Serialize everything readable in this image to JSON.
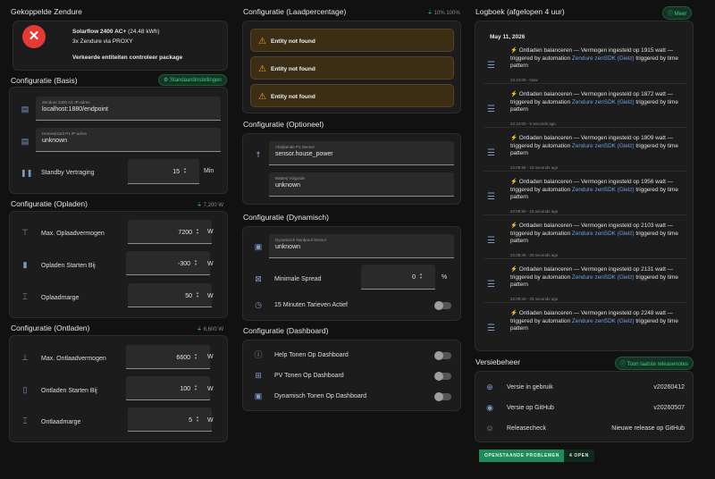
{
  "left": {
    "linked": {
      "title": "Gekoppelde Zendure",
      "device_name": "Solarflow 2400 AC+",
      "device_capacity": "(24.48 kWh)",
      "via": "3x Zendure via PROXY",
      "warning": "Verkeerde entiteiten controleer package"
    },
    "basis": {
      "title": "Configuratie (Basis)",
      "badge": "Standaardinstellingen",
      "ip_label": "Zendure 2400 AC IP-adres",
      "ip_value": "localhost:1880/endpoint",
      "p1_label": "Homewizard P1 IP-adres",
      "p1_value": "unknown",
      "standby_label": "Standby Vertraging",
      "standby_value": "15",
      "standby_unit": "Min"
    },
    "opladen": {
      "title": "Configuratie (Opladen)",
      "badge": "7,200 W",
      "rows": [
        {
          "label": "Max. Oplaadvermogen",
          "value": "7200",
          "unit": "W"
        },
        {
          "label": "Opladen Starten Bij",
          "value": "-300",
          "unit": "W"
        },
        {
          "label": "Oplaadmarge",
          "value": "50",
          "unit": "W"
        }
      ]
    },
    "ontladen": {
      "title": "Configuratie (Ontladen)",
      "badge": "6,600 W",
      "rows": [
        {
          "label": "Max. Ontlaadvermogen",
          "value": "6600",
          "unit": "W"
        },
        {
          "label": "Ontladen Starten Bij",
          "value": "100",
          "unit": "W"
        },
        {
          "label": "Ontlaadmarge",
          "value": "5",
          "unit": "W"
        }
      ]
    }
  },
  "middle": {
    "laad": {
      "title": "Configuratie (Laadpercentage)",
      "badge": "10%  100%",
      "warnings": [
        "Entity not found",
        "Entity not found",
        "Entity not found"
      ]
    },
    "optioneel": {
      "title": "Configuratie (Optioneel)",
      "p1_label": "Afwijkende P1 Sensor",
      "p1_value": "sensor.house_power",
      "bat_label": "Batterij Volgorde",
      "bat_value": "unknown"
    },
    "dynamisch": {
      "title": "Configuratie (Dynamisch)",
      "sensor_label": "Dynamisch Nordpool Sensor",
      "sensor_value": "unknown",
      "spread_label": "Minimale Spread",
      "spread_value": "0",
      "spread_unit": "%",
      "tarieven_label": "15 Minuten Tarieven Actief"
    },
    "dashboard": {
      "title": "Configuratie (Dashboard)",
      "rows": [
        "Help Tonen Op Dashboard",
        "PV Tonen Op Dashboard",
        "Dynamisch Tonen Op Dashboard"
      ]
    }
  },
  "right": {
    "log": {
      "title": "Logboek (afgelopen 4 uur)",
      "badge": "Meer",
      "date": "May 11, 2026",
      "entries": [
        {
          "pre": "Ontladen balanceren — Vermogen ingesteld op 1915 watt — triggered by automation ",
          "auto": "Zendure zenSDK (Gielz)",
          "post": " triggered by time pattern",
          "time": "22:10:05 - Now"
        },
        {
          "pre": "Ontladen balanceren — Vermogen ingesteld op 1872 watt — triggered by automation ",
          "auto": "Zendure zenSDK (Gielz)",
          "post": " triggered by time pattern",
          "time": "22:10:00 - 5 seconds ago"
        },
        {
          "pre": "Ontladen balanceren — Vermogen ingesteld op 1809 watt — triggered by automation ",
          "auto": "Zendure zenSDK (Gielz)",
          "post": " triggered by time pattern",
          "time": "22:09:55 - 10 seconds ago"
        },
        {
          "pre": "Ontladen balanceren — Vermogen ingesteld op 1956 watt — triggered by automation ",
          "auto": "Zendure zenSDK (Gielz)",
          "post": " triggered by time pattern",
          "time": "22:09:50 - 15 seconds ago"
        },
        {
          "pre": "Ontladen balanceren — Vermogen ingesteld op 2103 watt — triggered by automation ",
          "auto": "Zendure zenSDK (Gielz)",
          "post": " triggered by time pattern",
          "time": "22:09:45 - 20 seconds ago"
        },
        {
          "pre": "Ontladen balanceren — Vermogen ingesteld op 2131 watt — triggered by automation ",
          "auto": "Zendure zenSDK (Gielz)",
          "post": " triggered by time pattern",
          "time": "22:09:40 - 25 seconds ago"
        },
        {
          "pre": "Ontladen balanceren — Vermogen ingesteld op 2248 watt — triggered by automation ",
          "auto": "Zendure zenSDK (Gielz)",
          "post": " triggered by time pattern",
          "time": ""
        }
      ]
    },
    "versie": {
      "title": "Versiebeheer",
      "badge": "Toon laatste releasenotes",
      "rows": [
        {
          "label": "Versie in gebruik",
          "value": "v20260412"
        },
        {
          "label": "Versie op GitHub",
          "value": "v20260507"
        },
        {
          "label": "Releasecheck",
          "value": "Nieuwe release op GitHub"
        }
      ],
      "btn_problems": "OPENSTAANDE PROBLEMEN",
      "btn_open": "4 OPEN"
    }
  }
}
